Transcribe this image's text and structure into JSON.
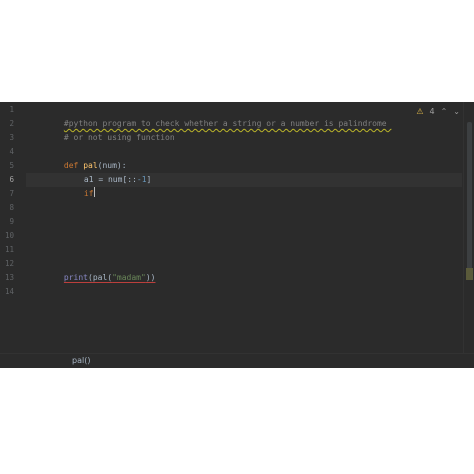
{
  "inspection": {
    "warning_count": "4",
    "warning_icon": "warning-triangle-icon",
    "up_icon": "chevron-up-icon",
    "down_icon": "chevron-down-icon"
  },
  "editor": {
    "line_numbers": [
      "1",
      "2",
      "3",
      "4",
      "5",
      "6",
      "7",
      "8",
      "9",
      "10",
      "11",
      "12",
      "13",
      "14"
    ],
    "lines": {
      "l1": "#python program to check whether a string or a number is palindrome ",
      "l2": "# or not using function",
      "l4_kw": "def",
      "l4_fn": "pal",
      "l4_rest": "(num):",
      "l5_var": "a1 = num[::",
      "l5_num": "-1",
      "l5_end": "]",
      "l6_kw": "if",
      "l12_print": "print",
      "l12_a": "(pal(",
      "l12_str": "\"madam\"",
      "l12_b": "))"
    },
    "active_line": "6"
  },
  "breadcrumb": {
    "text": "pal()"
  },
  "colors": {
    "background": "#2b2b2b",
    "keyword": "#cc7832",
    "function": "#ffc66d",
    "comment": "#808080",
    "string": "#6a8759",
    "number": "#6897bb"
  }
}
